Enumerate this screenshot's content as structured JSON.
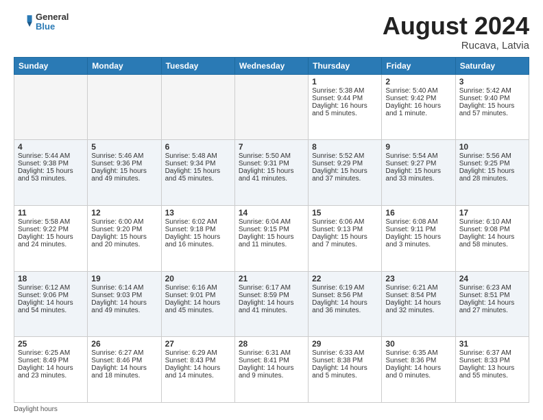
{
  "header": {
    "logo_line1": "General",
    "logo_line2": "Blue",
    "month_title": "August 2024",
    "location": "Rucava, Latvia"
  },
  "weekdays": [
    "Sunday",
    "Monday",
    "Tuesday",
    "Wednesday",
    "Thursday",
    "Friday",
    "Saturday"
  ],
  "footer": {
    "daylight_label": "Daylight hours"
  },
  "weeks": [
    [
      {
        "day": "",
        "info": ""
      },
      {
        "day": "",
        "info": ""
      },
      {
        "day": "",
        "info": ""
      },
      {
        "day": "",
        "info": ""
      },
      {
        "day": "1",
        "sunrise": "Sunrise: 5:38 AM",
        "sunset": "Sunset: 9:44 PM",
        "daylight": "Daylight: 16 hours and 5 minutes."
      },
      {
        "day": "2",
        "sunrise": "Sunrise: 5:40 AM",
        "sunset": "Sunset: 9:42 PM",
        "daylight": "Daylight: 16 hours and 1 minute."
      },
      {
        "day": "3",
        "sunrise": "Sunrise: 5:42 AM",
        "sunset": "Sunset: 9:40 PM",
        "daylight": "Daylight: 15 hours and 57 minutes."
      }
    ],
    [
      {
        "day": "4",
        "sunrise": "Sunrise: 5:44 AM",
        "sunset": "Sunset: 9:38 PM",
        "daylight": "Daylight: 15 hours and 53 minutes."
      },
      {
        "day": "5",
        "sunrise": "Sunrise: 5:46 AM",
        "sunset": "Sunset: 9:36 PM",
        "daylight": "Daylight: 15 hours and 49 minutes."
      },
      {
        "day": "6",
        "sunrise": "Sunrise: 5:48 AM",
        "sunset": "Sunset: 9:34 PM",
        "daylight": "Daylight: 15 hours and 45 minutes."
      },
      {
        "day": "7",
        "sunrise": "Sunrise: 5:50 AM",
        "sunset": "Sunset: 9:31 PM",
        "daylight": "Daylight: 15 hours and 41 minutes."
      },
      {
        "day": "8",
        "sunrise": "Sunrise: 5:52 AM",
        "sunset": "Sunset: 9:29 PM",
        "daylight": "Daylight: 15 hours and 37 minutes."
      },
      {
        "day": "9",
        "sunrise": "Sunrise: 5:54 AM",
        "sunset": "Sunset: 9:27 PM",
        "daylight": "Daylight: 15 hours and 33 minutes."
      },
      {
        "day": "10",
        "sunrise": "Sunrise: 5:56 AM",
        "sunset": "Sunset: 9:25 PM",
        "daylight": "Daylight: 15 hours and 28 minutes."
      }
    ],
    [
      {
        "day": "11",
        "sunrise": "Sunrise: 5:58 AM",
        "sunset": "Sunset: 9:22 PM",
        "daylight": "Daylight: 15 hours and 24 minutes."
      },
      {
        "day": "12",
        "sunrise": "Sunrise: 6:00 AM",
        "sunset": "Sunset: 9:20 PM",
        "daylight": "Daylight: 15 hours and 20 minutes."
      },
      {
        "day": "13",
        "sunrise": "Sunrise: 6:02 AM",
        "sunset": "Sunset: 9:18 PM",
        "daylight": "Daylight: 15 hours and 16 minutes."
      },
      {
        "day": "14",
        "sunrise": "Sunrise: 6:04 AM",
        "sunset": "Sunset: 9:15 PM",
        "daylight": "Daylight: 15 hours and 11 minutes."
      },
      {
        "day": "15",
        "sunrise": "Sunrise: 6:06 AM",
        "sunset": "Sunset: 9:13 PM",
        "daylight": "Daylight: 15 hours and 7 minutes."
      },
      {
        "day": "16",
        "sunrise": "Sunrise: 6:08 AM",
        "sunset": "Sunset: 9:11 PM",
        "daylight": "Daylight: 15 hours and 3 minutes."
      },
      {
        "day": "17",
        "sunrise": "Sunrise: 6:10 AM",
        "sunset": "Sunset: 9:08 PM",
        "daylight": "Daylight: 14 hours and 58 minutes."
      }
    ],
    [
      {
        "day": "18",
        "sunrise": "Sunrise: 6:12 AM",
        "sunset": "Sunset: 9:06 PM",
        "daylight": "Daylight: 14 hours and 54 minutes."
      },
      {
        "day": "19",
        "sunrise": "Sunrise: 6:14 AM",
        "sunset": "Sunset: 9:03 PM",
        "daylight": "Daylight: 14 hours and 49 minutes."
      },
      {
        "day": "20",
        "sunrise": "Sunrise: 6:16 AM",
        "sunset": "Sunset: 9:01 PM",
        "daylight": "Daylight: 14 hours and 45 minutes."
      },
      {
        "day": "21",
        "sunrise": "Sunrise: 6:17 AM",
        "sunset": "Sunset: 8:59 PM",
        "daylight": "Daylight: 14 hours and 41 minutes."
      },
      {
        "day": "22",
        "sunrise": "Sunrise: 6:19 AM",
        "sunset": "Sunset: 8:56 PM",
        "daylight": "Daylight: 14 hours and 36 minutes."
      },
      {
        "day": "23",
        "sunrise": "Sunrise: 6:21 AM",
        "sunset": "Sunset: 8:54 PM",
        "daylight": "Daylight: 14 hours and 32 minutes."
      },
      {
        "day": "24",
        "sunrise": "Sunrise: 6:23 AM",
        "sunset": "Sunset: 8:51 PM",
        "daylight": "Daylight: 14 hours and 27 minutes."
      }
    ],
    [
      {
        "day": "25",
        "sunrise": "Sunrise: 6:25 AM",
        "sunset": "Sunset: 8:49 PM",
        "daylight": "Daylight: 14 hours and 23 minutes."
      },
      {
        "day": "26",
        "sunrise": "Sunrise: 6:27 AM",
        "sunset": "Sunset: 8:46 PM",
        "daylight": "Daylight: 14 hours and 18 minutes."
      },
      {
        "day": "27",
        "sunrise": "Sunrise: 6:29 AM",
        "sunset": "Sunset: 8:43 PM",
        "daylight": "Daylight: 14 hours and 14 minutes."
      },
      {
        "day": "28",
        "sunrise": "Sunrise: 6:31 AM",
        "sunset": "Sunset: 8:41 PM",
        "daylight": "Daylight: 14 hours and 9 minutes."
      },
      {
        "day": "29",
        "sunrise": "Sunrise: 6:33 AM",
        "sunset": "Sunset: 8:38 PM",
        "daylight": "Daylight: 14 hours and 5 minutes."
      },
      {
        "day": "30",
        "sunrise": "Sunrise: 6:35 AM",
        "sunset": "Sunset: 8:36 PM",
        "daylight": "Daylight: 14 hours and 0 minutes."
      },
      {
        "day": "31",
        "sunrise": "Sunrise: 6:37 AM",
        "sunset": "Sunset: 8:33 PM",
        "daylight": "Daylight: 13 hours and 55 minutes."
      }
    ]
  ]
}
